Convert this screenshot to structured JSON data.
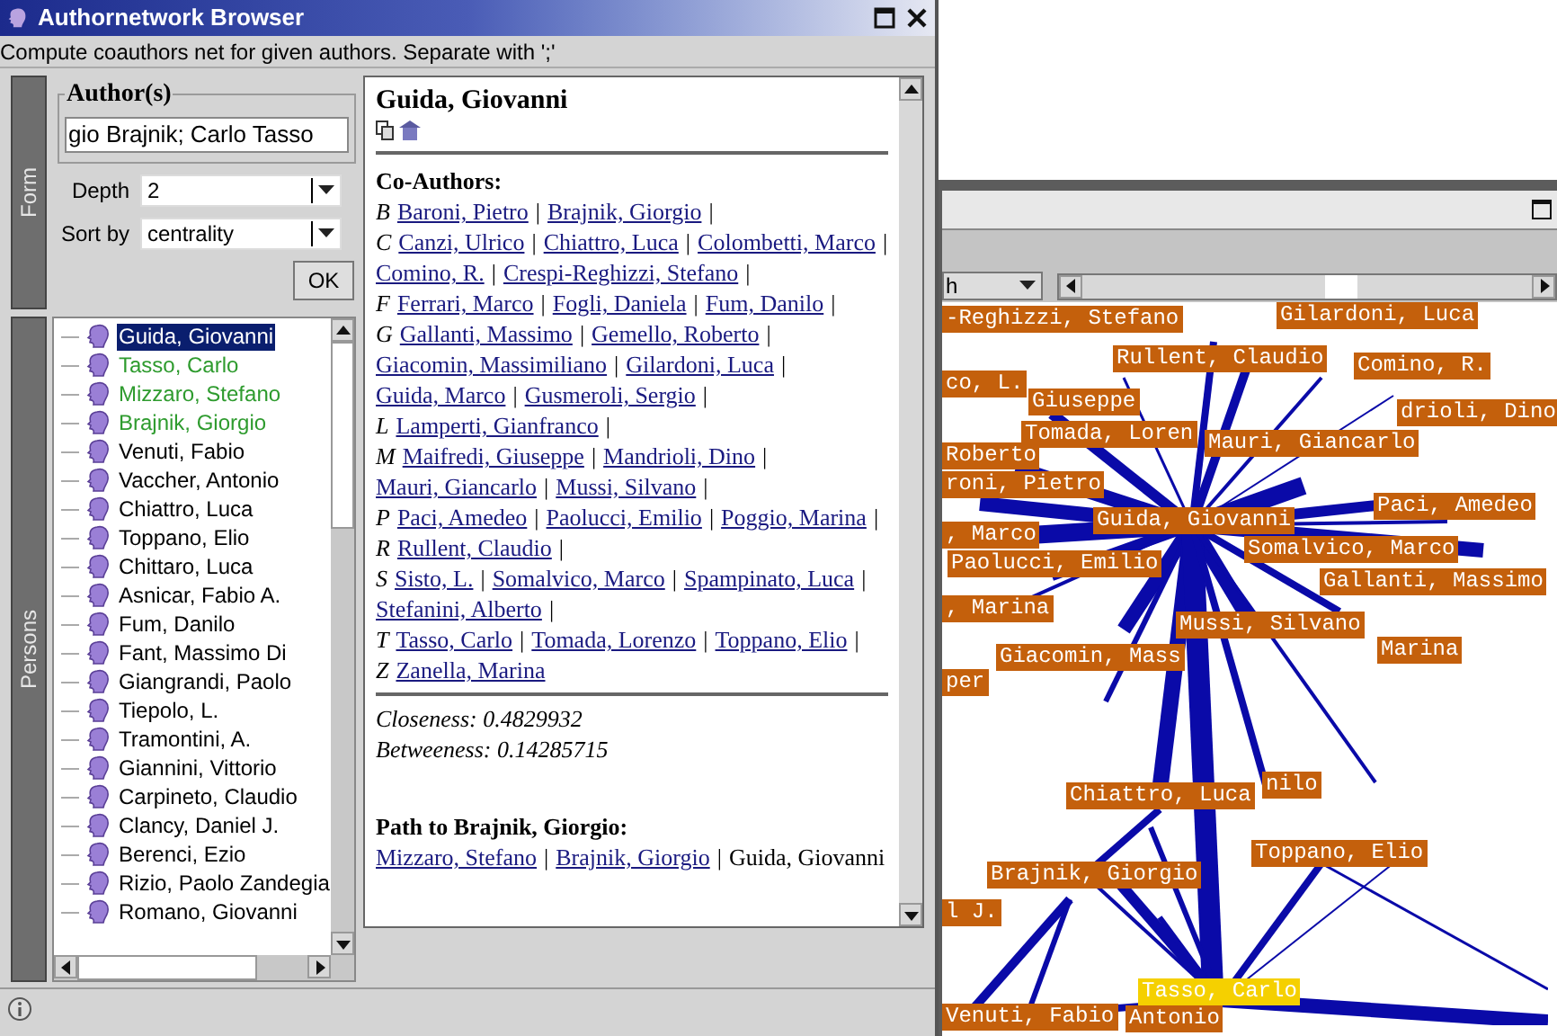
{
  "window": {
    "title": "Authornetwork Browser"
  },
  "hint": "Compute coauthors net for given authors. Separate with ';'",
  "form": {
    "tab": "Form",
    "authors_legend": "Author(s)",
    "authors_value": "gio Brajnik; Carlo Tasso",
    "depth_label": "Depth",
    "depth_value": "2",
    "sort_label": "Sort by",
    "sort_value": "centrality",
    "ok": "OK"
  },
  "persons": {
    "tab": "Persons",
    "items": [
      {
        "name": "Guida, Giovanni",
        "selected": true
      },
      {
        "name": "Tasso, Carlo",
        "selected": false,
        "color": "#2e9b2e"
      },
      {
        "name": "Mizzaro, Stefano",
        "selected": false,
        "color": "#2e9b2e"
      },
      {
        "name": "Brajnik, Giorgio",
        "selected": false,
        "color": "#2e9b2e"
      },
      {
        "name": "Venuti, Fabio",
        "selected": false,
        "color": "#000000"
      },
      {
        "name": "Vaccher, Antonio",
        "selected": false,
        "color": "#000000"
      },
      {
        "name": "Chiattro, Luca",
        "selected": false,
        "color": "#000000"
      },
      {
        "name": "Toppano, Elio",
        "selected": false,
        "color": "#000000"
      },
      {
        "name": "Chittaro, Luca",
        "selected": false,
        "color": "#000000"
      },
      {
        "name": "Asnicar, Fabio A.",
        "selected": false,
        "color": "#000000"
      },
      {
        "name": "Fum, Danilo",
        "selected": false,
        "color": "#000000"
      },
      {
        "name": "Fant, Massimo Di",
        "selected": false,
        "color": "#000000"
      },
      {
        "name": "Giangrandi, Paolo",
        "selected": false,
        "color": "#000000"
      },
      {
        "name": "Tiepolo, L.",
        "selected": false,
        "color": "#000000"
      },
      {
        "name": "Tramontini, A.",
        "selected": false,
        "color": "#000000"
      },
      {
        "name": "Giannini, Vittorio",
        "selected": false,
        "color": "#000000"
      },
      {
        "name": "Carpineto, Claudio",
        "selected": false,
        "color": "#000000"
      },
      {
        "name": "Clancy, Daniel J.",
        "selected": false,
        "color": "#000000"
      },
      {
        "name": "Berenci, Ezio",
        "selected": false,
        "color": "#000000"
      },
      {
        "name": "Rizio, Paolo Zandegia",
        "selected": false,
        "color": "#000000"
      },
      {
        "name": "Romano, Giovanni",
        "selected": false,
        "color": "#000000"
      }
    ]
  },
  "details": {
    "name": "Guida, Giovanni",
    "coauthors_heading": "Co-Authors:",
    "separator": "|",
    "groups": [
      {
        "letter": "B",
        "names": [
          "Baroni, Pietro",
          "Brajnik, Giorgio"
        ]
      },
      {
        "letter": "C",
        "names": [
          "Canzi, Ulrico",
          "Chiattro, Luca",
          "Colombetti, Marco",
          "Comino, R.",
          "Crespi-Reghizzi, Stefano"
        ]
      },
      {
        "letter": "F",
        "names": [
          "Ferrari, Marco",
          "Fogli, Daniela",
          "Fum, Danilo"
        ]
      },
      {
        "letter": "G",
        "names": [
          "Gallanti, Massimo",
          "Gemello, Roberto",
          "Giacomin, Massimiliano",
          "Gilardoni, Luca",
          "Guida, Marco",
          "Gusmeroli, Sergio"
        ]
      },
      {
        "letter": "L",
        "names": [
          "Lamperti, Gianfranco"
        ]
      },
      {
        "letter": "M",
        "names": [
          "Maifredi, Giuseppe",
          "Mandrioli, Dino",
          "Mauri, Giancarlo",
          "Mussi, Silvano"
        ]
      },
      {
        "letter": "P",
        "names": [
          "Paci, Amedeo",
          "Paolucci, Emilio",
          "Poggio, Marina"
        ]
      },
      {
        "letter": "R",
        "names": [
          "Rullent, Claudio"
        ]
      },
      {
        "letter": "S",
        "names": [
          "Sisto, L.",
          "Somalvico, Marco",
          "Spampinato, Luca",
          "Stefanini, Alberto"
        ]
      },
      {
        "letter": "T",
        "names": [
          "Tasso, Carlo",
          "Tomada, Lorenzo",
          "Toppano, Elio"
        ]
      },
      {
        "letter": "Z",
        "names": [
          "Zanella, Marina"
        ]
      }
    ],
    "closeness": "Closeness: 0.4829932",
    "betweenness": "Betweeness: 0.14285715",
    "path_heading": "Path to Brajnik, Giorgio:",
    "path": [
      {
        "text": "Mizzaro, Stefano",
        "kind": "link"
      },
      {
        "text": "Brajnik, Giorgio",
        "kind": "link"
      },
      {
        "text": "Guida, Giovanni",
        "kind": "text"
      }
    ]
  },
  "graph": {
    "view_value": "h",
    "nodes": [
      {
        "label": "-Reghizzi, Stefano",
        "selected": false
      },
      {
        "label": "Gilardoni, Luca",
        "selected": false
      },
      {
        "label": "Rullent, Claudio",
        "selected": false
      },
      {
        "label": "Comino, R.",
        "selected": false
      },
      {
        "label": "co, L.",
        "selected": false
      },
      {
        "label": "Giuseppe",
        "selected": false
      },
      {
        "label": "Tomada, Loren",
        "selected": false
      },
      {
        "label": "Mauri, Giancarlo",
        "selected": false
      },
      {
        "label": "drioli, Dino",
        "selected": false
      },
      {
        "label": "Roberto",
        "selected": false
      },
      {
        "label": "roni, Pietro",
        "selected": false
      },
      {
        "label": ", Marco",
        "selected": false
      },
      {
        "label": "Guida, Giovanni",
        "selected": false
      },
      {
        "label": "Paci, Amedeo",
        "selected": false
      },
      {
        "label": "Somalvico, Marco",
        "selected": false
      },
      {
        "label": "Paolucci, Emilio",
        "selected": false
      },
      {
        "label": "Gallanti, Massimo",
        "selected": false
      },
      {
        "label": ", Marina",
        "selected": false
      },
      {
        "label": "Mussi, Silvano",
        "selected": false
      },
      {
        "label": "Giacomin, Mass",
        "selected": false
      },
      {
        "label": "Marina",
        "selected": false
      },
      {
        "label": "per",
        "selected": false
      },
      {
        "label": "Chiattro, Luca",
        "selected": false
      },
      {
        "label": "nilo",
        "selected": false
      },
      {
        "label": "Toppano, Elio",
        "selected": false
      },
      {
        "label": "Brajnik, Giorgio",
        "selected": false
      },
      {
        "label": "l J.",
        "selected": false
      },
      {
        "label": "Venuti, Fabio",
        "selected": false
      },
      {
        "label": "Tasso, Carlo",
        "selected": true
      },
      {
        "label": "Antonio",
        "selected": false
      }
    ]
  }
}
